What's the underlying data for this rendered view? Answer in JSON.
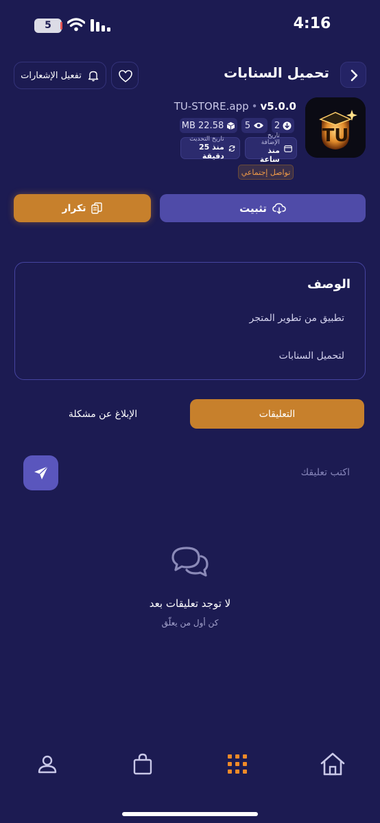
{
  "status_bar": {
    "time": "4:16",
    "battery": "5"
  },
  "header": {
    "title": "تحميل السنابات",
    "notifications_label": "تفعيل الإشعارات"
  },
  "app": {
    "version": "v5.0.0",
    "developer": "TU-STORE.app",
    "size": "MB 22.58",
    "views": "5",
    "downloads": "2",
    "added_label": "تاريخ الإضافة",
    "added_value": "منذ ساعة",
    "updated_label": "تاريخ التحديث",
    "updated_value": "منذ 25 دقيقة",
    "category": "تواصل إجتماعي"
  },
  "actions": {
    "install_label": "تثبيت",
    "copy_label": "تكرار"
  },
  "description": {
    "title": "الوصف",
    "lines": [
      "تطبيق من تطوير المتجر",
      "لتحميل السنابات"
    ]
  },
  "tabs": {
    "comments": "التعليقات",
    "report": "الإبلاغ عن مشكلة"
  },
  "comment": {
    "placeholder": "اكتب تعليقك"
  },
  "empty_state": {
    "title": "لا توجد تعليقات بعد",
    "subtitle": "كن أول من يعلّق"
  },
  "nav": [
    "profile-icon",
    "bag-icon",
    "grid-icon",
    "home-icon"
  ],
  "colors": {
    "background": "#1c1b52",
    "accent_orange": "#c7802c",
    "accent_purple": "#4f4ba8",
    "active_nav": "#f08a28"
  }
}
